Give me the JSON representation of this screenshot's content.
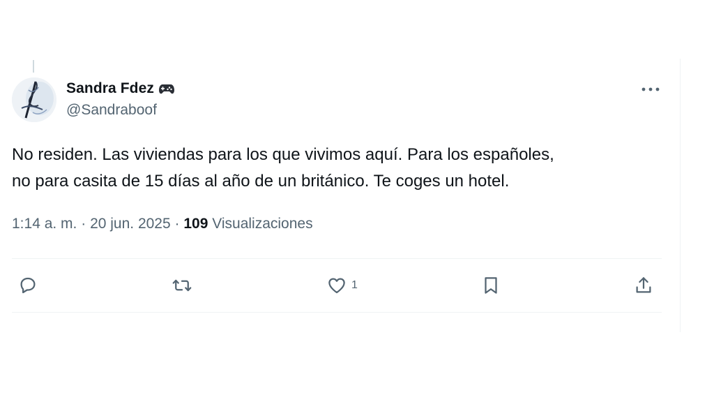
{
  "tweet": {
    "author": {
      "name": "Sandra Fdez",
      "handle": "@Sandraboof",
      "badge_icon": "gamepad-icon"
    },
    "text_lines": [
      "No residen. Las viviendas para los que vivimos aquí. Para los españoles,",
      "no para casita de 15 días al año de un británico. Te coges un hotel."
    ],
    "time": "1:14 a. m.",
    "separator": "·",
    "date": "20 jun. 2025",
    "views_count": "109",
    "views_label": "Visualizaciones",
    "actions": {
      "reply_icon": "reply-icon",
      "retweet_icon": "retweet-icon",
      "like_icon": "heart-icon",
      "like_count": "1",
      "bookmark_icon": "bookmark-icon",
      "share_icon": "share-icon"
    },
    "more_icon": "more-options-icon"
  },
  "colors": {
    "text_primary": "#0f1419",
    "text_secondary": "#536471",
    "divider": "#eff3f4"
  }
}
